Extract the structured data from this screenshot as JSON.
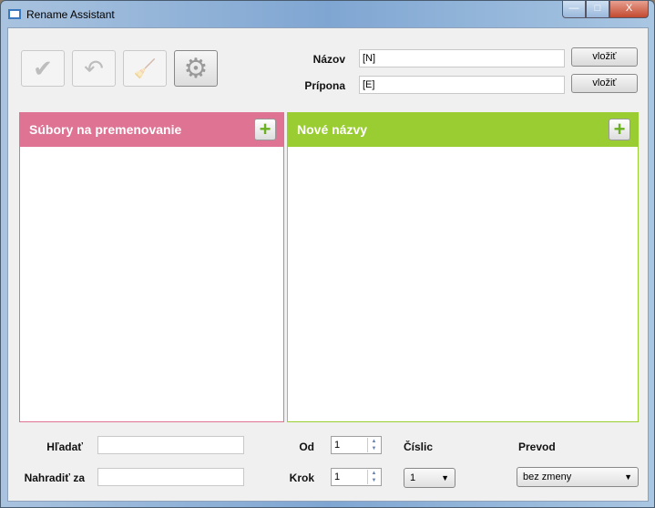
{
  "window": {
    "title": "Rename Assistant",
    "minimize": "—",
    "maximize": "□",
    "close": "X"
  },
  "toolbar": {
    "apply": "✔",
    "undo": "↶",
    "clear": "🧹",
    "settings": "⚙"
  },
  "naming": {
    "name_label": "Názov",
    "name_value": "[N]",
    "ext_label": "Prípona",
    "ext_value": "[E]",
    "insert_label": "vložiť"
  },
  "panels": {
    "files_title": "Súbory na premenovanie",
    "new_title": "Nové názvy",
    "add": "+",
    "files_color": "#de7394",
    "new_color": "#9acd32"
  },
  "bottom": {
    "search_label": "Hľadať",
    "search_value": "",
    "replace_label": "Nahradiť za",
    "replace_value": "",
    "from_label": "Od",
    "from_value": "1",
    "step_label": "Krok",
    "step_value": "1",
    "digits_label": "Číslic",
    "digits_value": "1",
    "convert_label": "Prevod",
    "convert_value": "bez zmeny"
  }
}
